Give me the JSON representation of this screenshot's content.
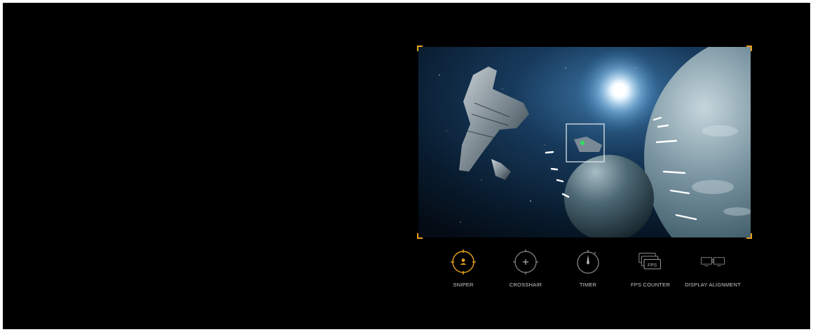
{
  "colors": {
    "accent": "#e8a21b",
    "icon_inactive": "#8a8a8a",
    "label": "#c9c9c9",
    "background": "#000000"
  },
  "toolbar": {
    "items": [
      {
        "id": "sniper",
        "label": "SNIPER",
        "icon": "sniper-scope-icon",
        "active": true
      },
      {
        "id": "crosshair",
        "label": "CROSSHAIR",
        "icon": "crosshair-icon",
        "active": false
      },
      {
        "id": "timer",
        "label": "TIMER",
        "icon": "timer-icon",
        "active": false
      },
      {
        "id": "fps",
        "label": "FPS COUNTER",
        "icon": "fps-counter-icon",
        "active": false,
        "icon_text": "FPS"
      },
      {
        "id": "display",
        "label": "DISPLAY ALIGNMENT",
        "icon": "display-alignment-icon",
        "active": false
      }
    ]
  }
}
